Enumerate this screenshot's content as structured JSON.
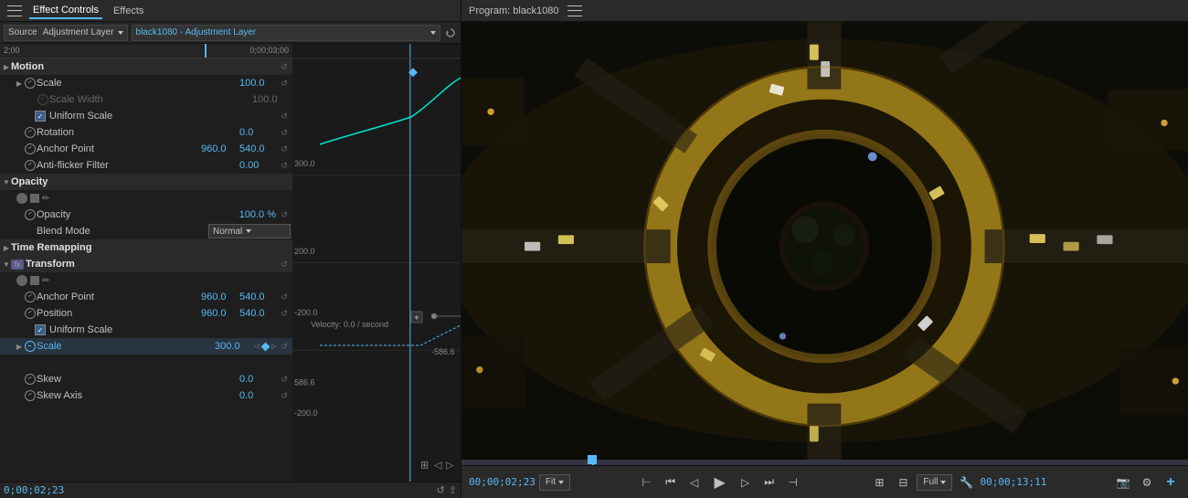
{
  "leftPanel": {
    "tabs": [
      {
        "label": "Effect Controls",
        "active": true
      },
      {
        "label": "Effects",
        "active": false
      }
    ],
    "sourceLabel": "Source",
    "sourceDropdown": "Adjustment Layer",
    "clipName": "black1080 - Adjustment Layer",
    "timecodes": {
      "start": "2;00",
      "end": "0;00;03;00",
      "current": "0;00;02;23"
    },
    "sections": [
      {
        "name": "Motion",
        "expanded": false,
        "properties": [
          {
            "name": "Scale",
            "value": "100.0",
            "hasStopwatch": true,
            "hasReset": true
          },
          {
            "name": "Scale Width",
            "value": "100.0",
            "hasStopwatch": true,
            "disabled": true
          },
          {
            "name": "Uniform Scale",
            "type": "checkbox",
            "checked": true
          },
          {
            "name": "Rotation",
            "value": "0.0",
            "hasStopwatch": true,
            "hasReset": true
          },
          {
            "name": "Anchor Point",
            "value": "960.0  540.0",
            "hasStopwatch": true,
            "hasReset": true
          },
          {
            "name": "Anti-flicker Filter",
            "value": "0.00",
            "hasStopwatch": true,
            "hasReset": true
          }
        ]
      },
      {
        "name": "Opacity",
        "expanded": true,
        "properties": [
          {
            "name": "Opacity",
            "value": "100.0 %",
            "hasStopwatch": true,
            "hasReset": true
          },
          {
            "name": "Blend Mode",
            "value": "Normal",
            "type": "dropdown"
          }
        ]
      },
      {
        "name": "Time Remapping",
        "expanded": false,
        "properties": []
      },
      {
        "name": "Transform",
        "expanded": true,
        "isFx": true,
        "properties": [
          {
            "name": "Anchor Point",
            "value": "960.0  540.0",
            "hasStopwatch": true,
            "hasReset": true
          },
          {
            "name": "Position",
            "value": "960.0  540.0",
            "hasStopwatch": true,
            "hasReset": true
          },
          {
            "name": "Uniform Scale",
            "type": "checkbox",
            "checked": true
          },
          {
            "name": "Scale",
            "value": "300.0",
            "hasStopwatch": true,
            "hasReset": true,
            "highlighted": true,
            "hasKeyframe": true
          },
          {
            "name": "Skew",
            "value": "0.0",
            "hasStopwatch": true,
            "hasReset": true
          },
          {
            "name": "Skew Axis",
            "value": "0.0",
            "hasStopwatch": true,
            "hasReset": true
          }
        ]
      }
    ],
    "graphValues": {
      "val300": "300.0",
      "val200": "200.0",
      "valNeg200": "-200.0",
      "val5866": "586.6",
      "valNeg5866": "-586.6",
      "valNeg200left": "-200.0",
      "velocity": "Velocity: 0.0 / second"
    }
  },
  "rightPanel": {
    "title": "Program: black1080",
    "currentTime": "00;00;02;23",
    "duration": "00;00;13;11",
    "fitOption": "Fit",
    "qualityOption": "Full",
    "controls": {
      "stepBack": "⏮",
      "stepBackFrame": "◁",
      "play": "▶",
      "stepForwardFrame": "▷",
      "stepForward": "⏭"
    }
  }
}
